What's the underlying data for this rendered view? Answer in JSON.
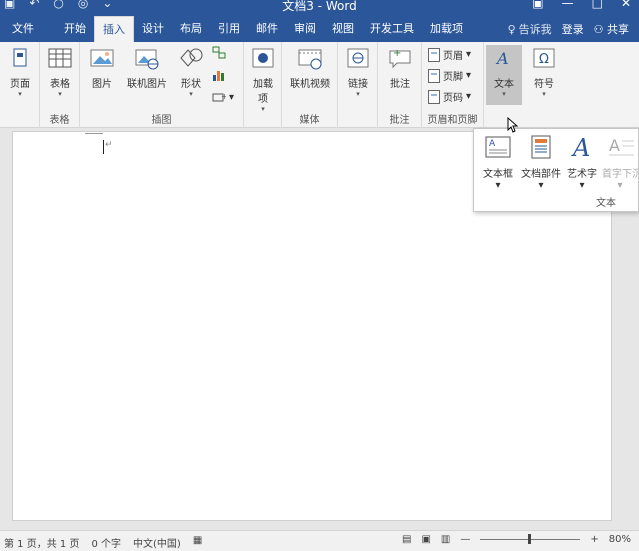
{
  "window": {
    "title": "文档3 - Word"
  },
  "tabs": [
    {
      "label": "文件"
    },
    {
      "label": "开始"
    },
    {
      "label": "插入"
    },
    {
      "label": "设计"
    },
    {
      "label": "布局"
    },
    {
      "label": "引用"
    },
    {
      "label": "邮件"
    },
    {
      "label": "审阅"
    },
    {
      "label": "视图"
    },
    {
      "label": "开发工具"
    },
    {
      "label": "加载项"
    }
  ],
  "active_tab": "插入",
  "tell_me": "告诉我",
  "login": "登录",
  "share": "共享",
  "ribbon": {
    "groups": {
      "pages": {
        "button": "页面"
      },
      "tables": {
        "button": "表格",
        "label": "表格"
      },
      "illustrations": {
        "label": "插图",
        "picture": "图片",
        "online_picture": "联机图片",
        "shapes": "形状"
      },
      "addins": {
        "button": "加载项"
      },
      "media": {
        "label": "媒体",
        "online_video": "联机视频"
      },
      "links": {
        "button": "链接"
      },
      "comments": {
        "label": "批注",
        "button": "批注"
      },
      "header_footer": {
        "label": "页眉和页脚",
        "header": "页眉",
        "footer": "页脚",
        "page_number": "页码"
      },
      "text": {
        "button": "文本"
      },
      "symbols": {
        "button": "符号"
      }
    }
  },
  "text_dropdown": {
    "items": [
      {
        "label": "文本框"
      },
      {
        "label": "文档部件"
      },
      {
        "label": "艺术字"
      },
      {
        "label": "首字下沉"
      }
    ],
    "group_label": "文本"
  },
  "status": {
    "page_info": "第 1 页，共 1 页",
    "word_count": "0 个字",
    "language": "中文(中国)",
    "zoom": "80%"
  },
  "colors": {
    "accent": "#2b579a",
    "ribbon_bg": "#f3f3f3",
    "canvas_bg": "#e6e6e6"
  }
}
